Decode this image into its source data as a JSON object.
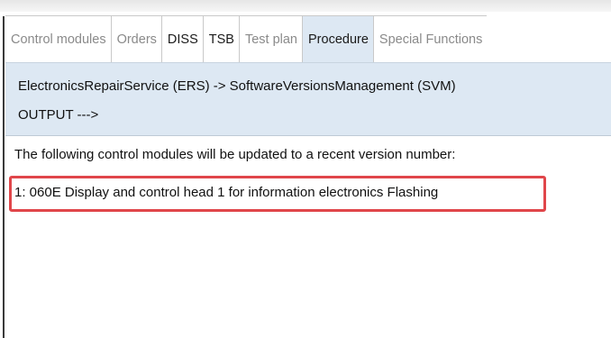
{
  "tabs": [
    {
      "label": "Control modules",
      "state": "inactive"
    },
    {
      "label": "Orders",
      "state": "inactive"
    },
    {
      "label": "DISS",
      "state": "bold"
    },
    {
      "label": "TSB",
      "state": "bold"
    },
    {
      "label": "Test plan",
      "state": "inactive"
    },
    {
      "label": "Procedure",
      "state": "active"
    },
    {
      "label": "Special Functions",
      "state": "inactive"
    }
  ],
  "panel": {
    "path": "ElectronicsRepairService (ERS) -> SoftwareVersionsManagement (SVM)",
    "output_label": "OUTPUT --->"
  },
  "content": {
    "intro": "The following control modules will be updated to a recent version number:",
    "items": [
      "1: 060E Display and control head 1 for information electronics Flashing"
    ]
  },
  "colors": {
    "panel_bg": "#dde8f3",
    "highlight": "#e0464a",
    "inactive_tab_text": "#8a8a8a"
  }
}
